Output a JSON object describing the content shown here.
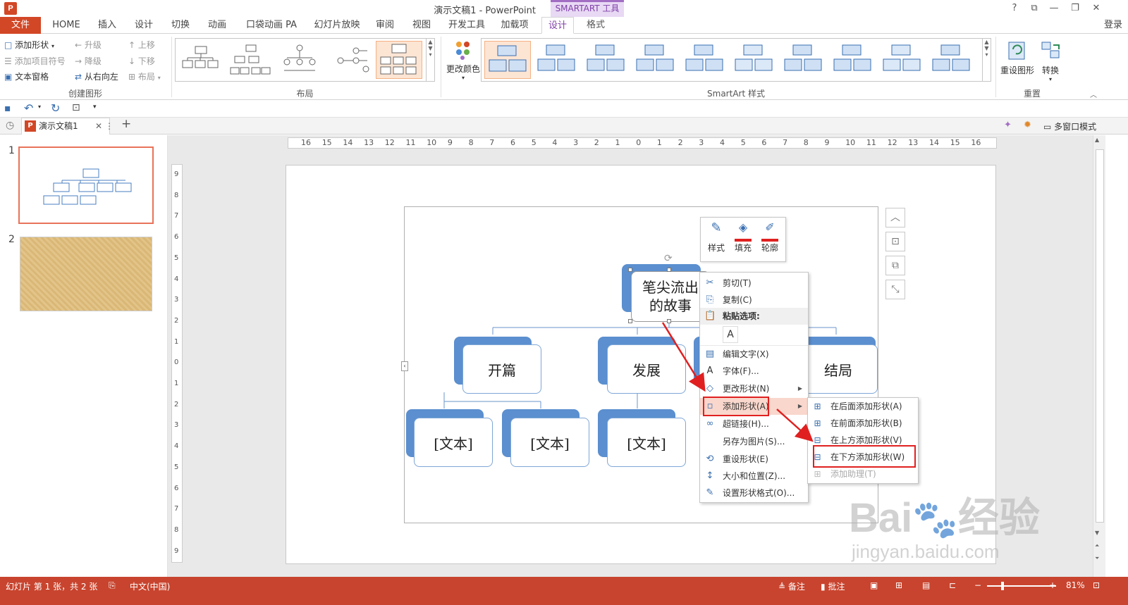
{
  "app": {
    "title": "演示文稿1 - PowerPoint",
    "icon_text": "P",
    "context_tab_header": "SMARTART 工具",
    "window_buttons": [
      "?",
      "⧉",
      "—",
      "❐",
      "✕"
    ],
    "signin": "登录"
  },
  "tabs": [
    {
      "label": "文件"
    },
    {
      "label": "HOME"
    },
    {
      "label": "插入"
    },
    {
      "label": "设计"
    },
    {
      "label": "切换"
    },
    {
      "label": "动画"
    },
    {
      "label": "口袋动画 PA"
    },
    {
      "label": "幻灯片放映"
    },
    {
      "label": "审阅"
    },
    {
      "label": "视图"
    },
    {
      "label": "开发工具"
    },
    {
      "label": "加载项"
    },
    {
      "label": "设计"
    },
    {
      "label": "格式"
    }
  ],
  "ribbon": {
    "create_graphic": {
      "items": [
        "添加形状",
        "添加项目符号",
        "文本窗格",
        "升级",
        "降级",
        "从右向左",
        "上移",
        "下移",
        "布局"
      ],
      "label": "创建图形"
    },
    "layout": {
      "label": "布局"
    },
    "change_colors": "更改颜色",
    "smartart_styles": {
      "label": "SmartArt 样式"
    },
    "reset": {
      "reset_graphic": "重设图形",
      "convert": "转换",
      "label": "重置"
    }
  },
  "doc_tab": {
    "name": "演示文稿1",
    "close": "✕",
    "more": "⋮",
    "add": "+"
  },
  "right_tools": {
    "multi_window": "多窗口模式"
  },
  "slides": [
    {
      "number": "1"
    },
    {
      "number": "2"
    }
  ],
  "ruler": {
    "horizontal": [
      "16",
      "15",
      "14",
      "13",
      "12",
      "11",
      "10",
      "9",
      "8",
      "7",
      "6",
      "5",
      "4",
      "3",
      "2",
      "1",
      "0",
      "1",
      "2",
      "3",
      "4",
      "5",
      "6",
      "7",
      "8",
      "9",
      "10",
      "11",
      "12",
      "13",
      "14",
      "15",
      "16"
    ],
    "vertical": [
      "9",
      "8",
      "7",
      "6",
      "5",
      "4",
      "3",
      "2",
      "1",
      "0",
      "1",
      "2",
      "3",
      "4",
      "5",
      "6",
      "7",
      "8",
      "9"
    ]
  },
  "smartart": {
    "root": "笔尖流出的故事",
    "root_line1": "笔尖流出",
    "root_line2": "的故事",
    "level2": [
      "开篇",
      "发展",
      "结局"
    ],
    "level3": [
      "[文本]",
      "[文本]",
      "[文本]"
    ]
  },
  "mini_toolbar": {
    "style": "样式",
    "fill": "填充",
    "outline": "轮廓"
  },
  "context_menu": {
    "items": [
      {
        "label": "剪切(T)",
        "icon": "scissors-icon"
      },
      {
        "label": "复制(C)",
        "icon": "copy-icon"
      },
      {
        "label": "粘贴选项:",
        "icon": "paste-icon"
      },
      {
        "label": "编辑文字(X)",
        "icon": "edit-text-icon"
      },
      {
        "label": "字体(F)...",
        "icon": "font-icon"
      },
      {
        "label": "更改形状(N)",
        "icon": "shape-icon"
      },
      {
        "label": "添加形状(A)",
        "icon": "add-shape-icon"
      },
      {
        "label": "超链接(H)...",
        "icon": "link-icon"
      },
      {
        "label": "另存为图片(S)...",
        "icon": ""
      },
      {
        "label": "重设形状(E)",
        "icon": "reset-icon"
      },
      {
        "label": "大小和位置(Z)...",
        "icon": "size-icon"
      },
      {
        "label": "设置形状格式(O)...",
        "icon": "format-icon"
      }
    ]
  },
  "submenu": {
    "items": [
      {
        "label": "在后面添加形状(A)",
        "disabled": false
      },
      {
        "label": "在前面添加形状(B)",
        "disabled": false
      },
      {
        "label": "在上方添加形状(V)",
        "disabled": false
      },
      {
        "label": "在下方添加形状(W)",
        "disabled": false
      },
      {
        "label": "添加助理(T)",
        "disabled": true
      }
    ]
  },
  "status": {
    "slide_info": "幻灯片 第 1 张，共 2 张",
    "language": "中文(中国)",
    "notes": "备注",
    "comments": "批注",
    "zoom": "81%"
  },
  "watermark": {
    "brand": "Bai",
    "brand2": "经验",
    "url": "jingyan.baidu.com"
  },
  "colors": {
    "accent": "#d24726",
    "context": "#7f3fa8",
    "smartart_blue": "#5b8fcf",
    "highlight": "#e02020"
  }
}
